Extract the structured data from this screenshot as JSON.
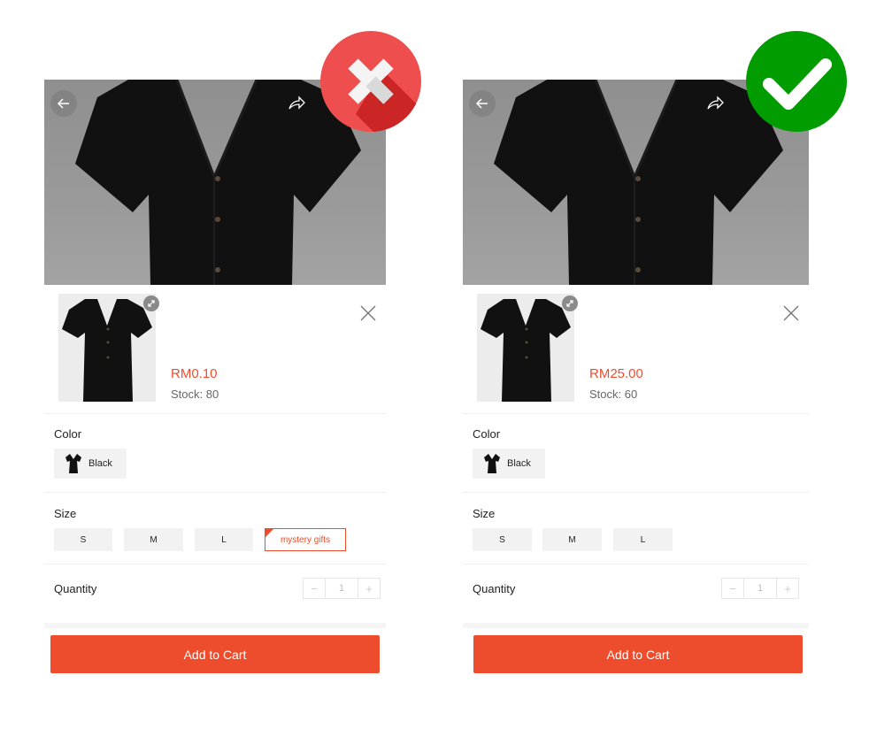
{
  "colors": {
    "accent": "#ee4d2d",
    "bad_badge": "#ef4e4e",
    "good_badge": "#009c00"
  },
  "left_panel": {
    "price": "RM0.10",
    "stock": "Stock: 80",
    "color_label": "Color",
    "color_option": "Black",
    "size_label": "Size",
    "sizes": [
      "S",
      "M",
      "L",
      "mystery gifts"
    ],
    "quantity_label": "Quantity",
    "quantity_value": "1",
    "qty_minus": "−",
    "qty_plus": "+",
    "cart_label": "Add to Cart",
    "badge_icon": "cross-mark-icon"
  },
  "right_panel": {
    "price": "RM25.00",
    "stock": "Stock: 60",
    "color_label": "Color",
    "color_option": "Black",
    "size_label": "Size",
    "sizes": [
      "S",
      "M",
      "L"
    ],
    "quantity_label": "Quantity",
    "quantity_value": "1",
    "qty_minus": "−",
    "qty_plus": "+",
    "cart_label": "Add to Cart",
    "badge_icon": "check-mark-icon"
  }
}
